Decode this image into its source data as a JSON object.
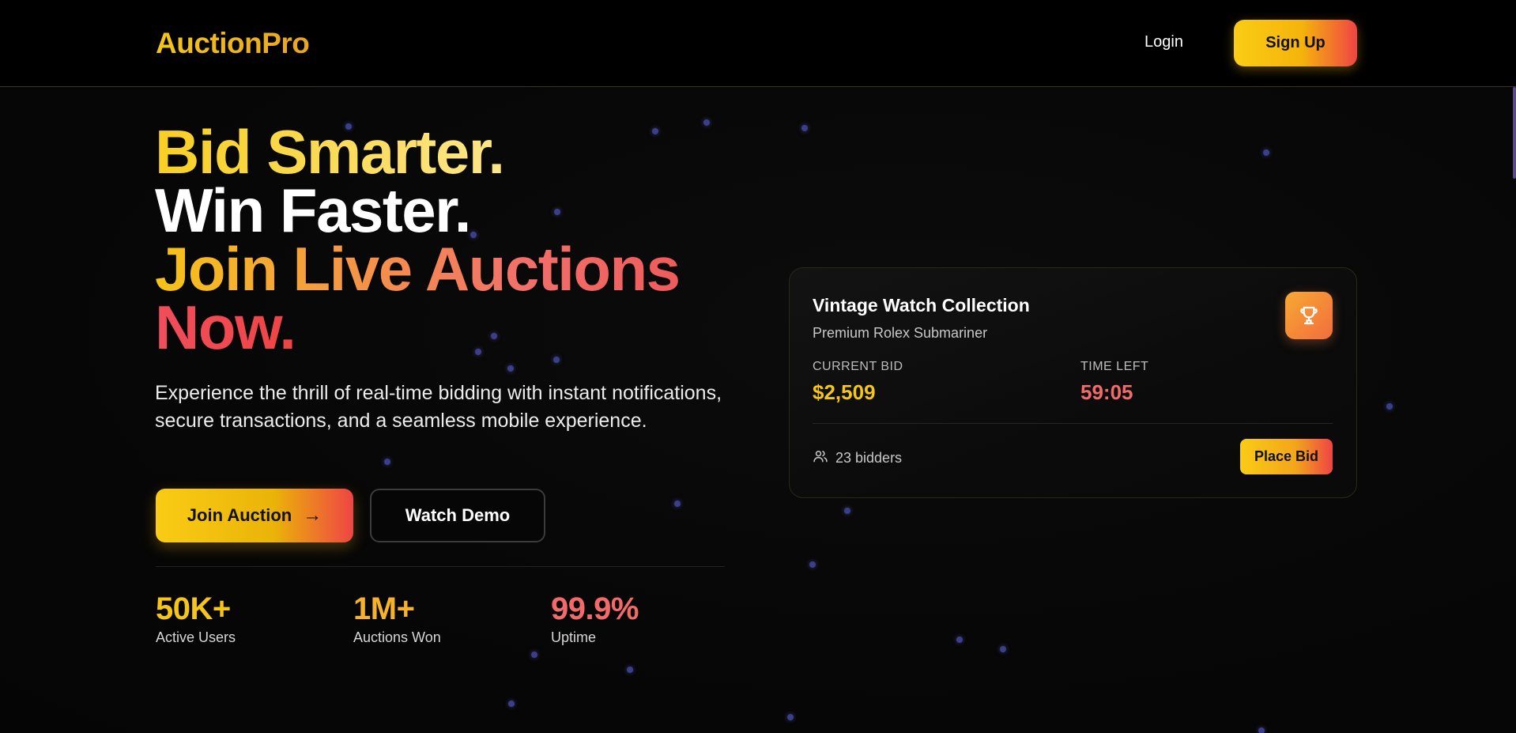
{
  "brand": {
    "name": "AuctionPro",
    "accent_yellow": "#facc15",
    "accent_red": "#ef4444"
  },
  "nav": {
    "login_label": "Login",
    "signup_label": "Sign Up"
  },
  "hero": {
    "line1": "Bid Smarter.",
    "line2": "Win Faster.",
    "line3": "Join Live Auctions",
    "line4": "Now.",
    "subtitle": "Experience the thrill of real-time bidding with instant notifications, secure transactions, and a seamless mobile experience.",
    "join_label": "Join Auction",
    "join_icon": "arrow-right-icon",
    "demo_label": "Watch Demo"
  },
  "stats": [
    {
      "value": "50K+",
      "label": "Active Users"
    },
    {
      "value": "1M+",
      "label": "Auctions Won"
    },
    {
      "value": "99.9%",
      "label": "Uptime"
    }
  ],
  "card": {
    "title": "Vintage Watch Collection",
    "subtitle": "Premium Rolex Submariner",
    "icon": "trophy-icon",
    "current_bid_label": "CURRENT BID",
    "current_bid_value": "$2,509",
    "time_left_label": "TIME LEFT",
    "time_left_value": "59:05",
    "bidders_icon": "users-icon",
    "bidders_text": "23 bidders",
    "place_bid_label": "Place Bid"
  }
}
